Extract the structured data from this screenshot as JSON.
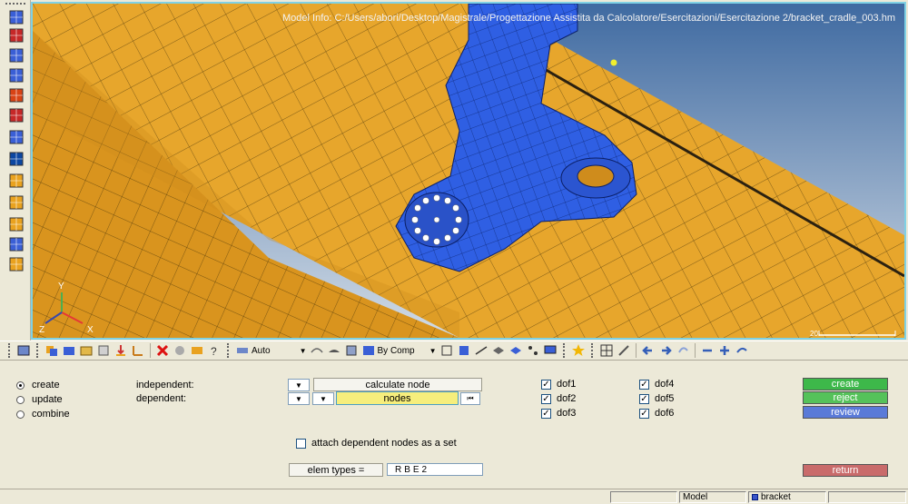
{
  "viewport": {
    "model_info": "Model Info: C:/Users/abori/Desktop/Magistrale/Progettazione Assistita da Calcolatore/Esercitazioni/Esercitazione 2/bracket_cradle_003.hm",
    "scale_label": "20",
    "axis_labels": {
      "y": "Y",
      "z": "Z",
      "x": "X"
    },
    "colors": {
      "background_top": "#4a74a8",
      "background_bottom": "#c9d6e3",
      "frame_mesh": "#e6a52b",
      "bracket_mesh": "#2e5fe0",
      "axis_y": "#4caf50",
      "axis_x": "#e53935",
      "axis_z": "#3949ab"
    }
  },
  "left_toolbar": {
    "icons": [
      "component-visibility-icon",
      "component-display-icon",
      "mesh-display-icon",
      "element-display-icon",
      "shaded-display-icon",
      "mask-icon",
      "find-icon",
      "numbers-icon",
      "measure-icon",
      "abc-element-icon",
      "abc-node-icon",
      "translate-icon",
      "entity-display-icon"
    ]
  },
  "icon_toolbar": {
    "auto_label": "Auto",
    "by_comp_label": "By Comp"
  },
  "panel": {
    "options": [
      {
        "label": "create",
        "selected": true
      },
      {
        "label": "update",
        "selected": false
      },
      {
        "label": "combine",
        "selected": false
      }
    ],
    "independent_label": "independent:",
    "dependent_label": "dependent:",
    "calculate_node_label": "calculate node",
    "nodes_label": "nodes",
    "dofs_left": [
      {
        "label": "dof1",
        "checked": true
      },
      {
        "label": "dof2",
        "checked": true
      },
      {
        "label": "dof3",
        "checked": true
      }
    ],
    "dofs_right": [
      {
        "label": "dof4",
        "checked": true
      },
      {
        "label": "dof5",
        "checked": true
      },
      {
        "label": "dof6",
        "checked": true
      }
    ],
    "attach_label": "attach dependent nodes as a set",
    "attach_checked": false,
    "elem_types_label": "elem types =",
    "elem_types_value": "RBE2",
    "create_label": "create",
    "reject_label": "reject",
    "review_label": "review",
    "return_label": "return"
  },
  "statusbar": {
    "model_label": "Model",
    "component_label": "bracket"
  }
}
